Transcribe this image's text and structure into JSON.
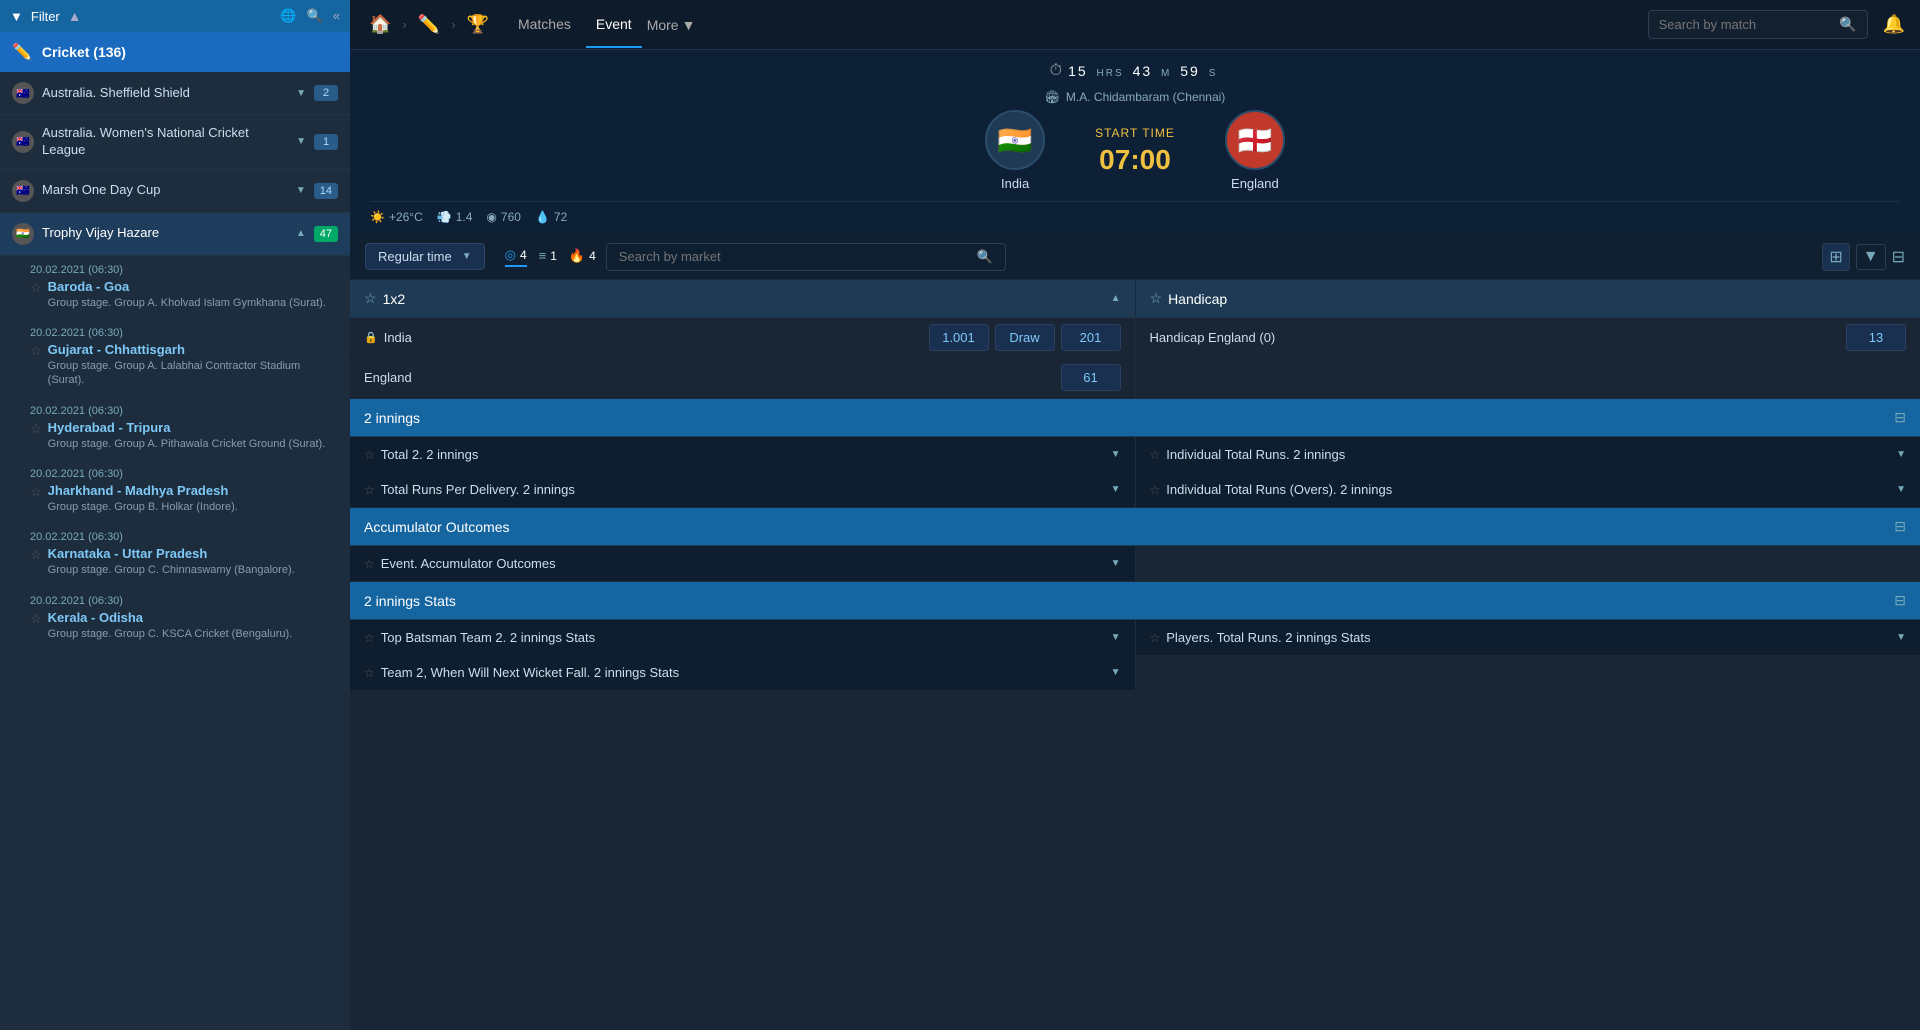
{
  "sidebar": {
    "filter_label": "Filter",
    "cricket_label": "Cricket (136)",
    "leagues": [
      {
        "id": "aus-sheffield",
        "name": "Australia. Sheffield Shield",
        "badge": "2",
        "flag": "🇦🇺",
        "active": false
      },
      {
        "id": "aus-womens",
        "name": "Australia. Women's National Cricket League",
        "badge": "1",
        "flag": "🇦🇺",
        "active": false
      },
      {
        "id": "marsh",
        "name": "Marsh One Day Cup",
        "badge": "14",
        "flag": "🇦🇺",
        "active": false
      },
      {
        "id": "trophy-vijay",
        "name": "Trophy Vijay Hazare",
        "badge": "47",
        "flag": "🇮🇳",
        "active": true
      }
    ],
    "matches": [
      {
        "date": "20.02.2021 (06:30)",
        "name": "Baroda - Goa",
        "venue": "Group stage. Group A. Kholvad Islam Gymkhana (Surat).",
        "fav": false
      },
      {
        "date": "20.02.2021 (06:30)",
        "name": "Gujarat - Chhattisgarh",
        "venue": "Group stage. Group A. Lalabhai Contractor Stadium (Surat).",
        "fav": false
      },
      {
        "date": "20.02.2021 (06:30)",
        "name": "Hyderabad - Tripura",
        "venue": "Group stage. Group A. Pithawala Cricket Ground (Surat).",
        "fav": false
      },
      {
        "date": "20.02.2021 (06:30)",
        "name": "Jharkhand - Madhya Pradesh",
        "venue": "Group stage. Group B. Holkar (Indore).",
        "fav": false
      },
      {
        "date": "20.02.2021 (06:30)",
        "name": "Karnataka - Uttar Pradesh",
        "venue": "Group stage. Group C. Chinnaswamy (Bangalore).",
        "fav": false
      },
      {
        "date": "20.02.2021 (06:30)",
        "name": "Kerala - Odisha",
        "venue": "Group stage. Group C. KSCA Cricket (Bengaluru).",
        "fav": false
      }
    ]
  },
  "topnav": {
    "tabs": [
      "Matches",
      "Event",
      "More"
    ],
    "active_tab": "Event",
    "search_placeholder": "Search by match"
  },
  "match": {
    "countdown": {
      "hours": "15",
      "hrs_label": "HRS",
      "minutes": "43",
      "m_label": "M",
      "seconds": "59",
      "s_label": "S"
    },
    "venue": "M.A. Chidambaram (Chennai)",
    "team1": {
      "name": "India",
      "flag": "🇮🇳"
    },
    "team2": {
      "name": "England",
      "flag": "🏴"
    },
    "start_time_label": "START TIME",
    "start_time": "07:00",
    "weather": {
      "temp": "+26°C",
      "wind": "1.4",
      "pressure": "760",
      "humidity": "72"
    }
  },
  "market_tabs": {
    "time_filter": "Regular time",
    "icons": [
      {
        "id": "circle",
        "count": "4",
        "active": true
      },
      {
        "id": "list",
        "count": "1",
        "active": false
      },
      {
        "id": "fire",
        "count": "4",
        "active": false
      }
    ],
    "search_placeholder": "Search by market"
  },
  "markets": {
    "sections": [
      {
        "id": "1x2",
        "title": "1x2",
        "rows": [
          {
            "label": "India",
            "locked": true,
            "odds": [
              "1.001",
              "Draw",
              "201"
            ]
          },
          {
            "label": "England",
            "locked": false,
            "odds": [
              "61",
              "",
              ""
            ]
          }
        ]
      },
      {
        "id": "handicap",
        "title": "Handicap",
        "rows": [
          {
            "label": "Handicap England (0)",
            "odds": [
              "13"
            ]
          }
        ]
      }
    ],
    "banners": [
      {
        "id": "2-innings",
        "title": "2 innings"
      },
      {
        "id": "accumulator",
        "title": "Accumulator Outcomes"
      },
      {
        "id": "2-innings-stats",
        "title": "2 innings Stats"
      }
    ],
    "collapsible_markets": [
      {
        "id": "total-2-innings",
        "title": "Total 2. 2 innings"
      },
      {
        "id": "total-runs-delivery",
        "title": "Total Runs Per Delivery. 2 innings"
      },
      {
        "id": "individual-total-runs",
        "title": "Individual Total Runs. 2 innings"
      },
      {
        "id": "individual-total-overs",
        "title": "Individual Total Runs (Overs). 2 innings"
      },
      {
        "id": "event-accumulator",
        "title": "Event. Accumulator Outcomes"
      },
      {
        "id": "top-batsman",
        "title": "Top Batsman Team 2. 2 innings Stats"
      },
      {
        "id": "next-wicket",
        "title": "Team 2, When Will Next Wicket Fall. 2 innings Stats"
      },
      {
        "id": "players-total-runs",
        "title": "Players. Total Runs. 2 innings Stats"
      }
    ]
  }
}
